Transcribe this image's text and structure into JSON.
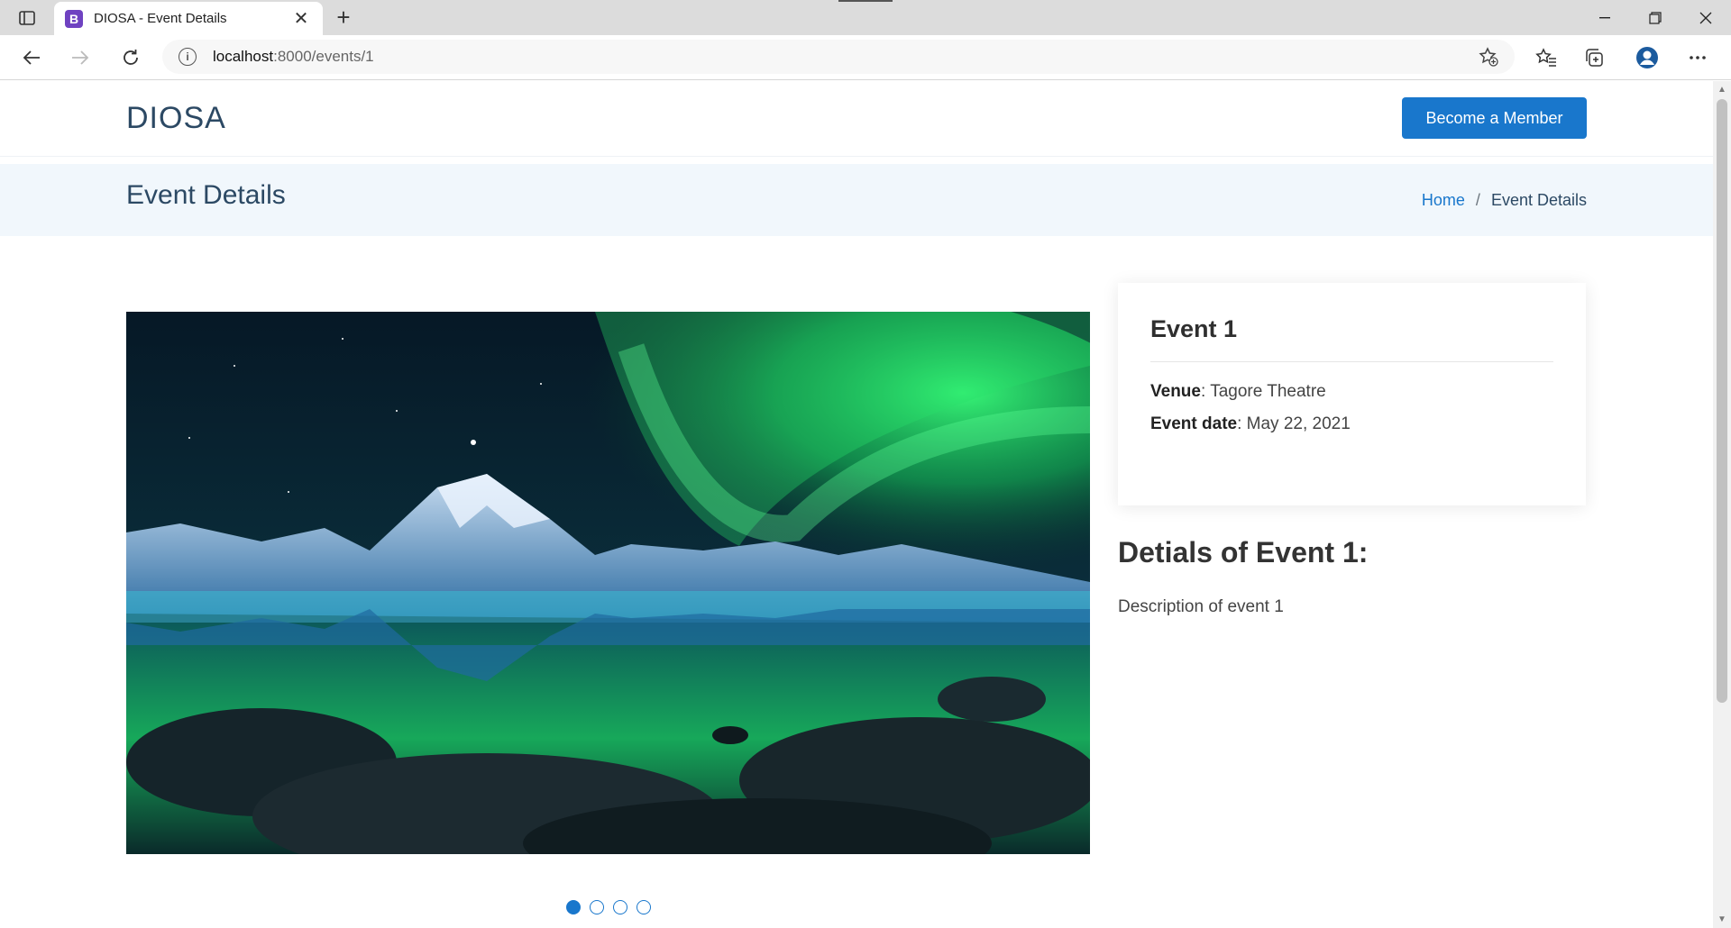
{
  "browser": {
    "tab_title": "DIOSA - Event Details",
    "favicon_letter": "B",
    "url_host": "localhost",
    "url_path": ":8000/events/1",
    "icons": {
      "tab_actions": "tab-actions-icon",
      "close": "close-icon",
      "new_tab": "plus-icon",
      "back": "back-arrow-icon",
      "forward": "forward-arrow-icon",
      "refresh": "refresh-icon",
      "site_info": "info-icon",
      "add_favorite": "star-plus-icon",
      "favorites": "favorites-icon",
      "collections": "collections-icon",
      "profile": "profile-icon",
      "more": "more-icon"
    }
  },
  "site": {
    "logo": "DIOSA",
    "cta_label": "Become a Member",
    "accent_color": "#1977cc"
  },
  "breadcrumbs": {
    "title": "Event Details",
    "home": "Home",
    "separator": "/",
    "current": "Event Details"
  },
  "carousel": {
    "slides": 4,
    "active_index": 0
  },
  "event": {
    "name": "Event 1",
    "venue_label": "Venue",
    "venue": ": Tagore Theatre",
    "date_label": "Event date",
    "date": ": May 22, 2021",
    "details_heading": "Detials of Event 1:",
    "description": "Description of event 1"
  }
}
